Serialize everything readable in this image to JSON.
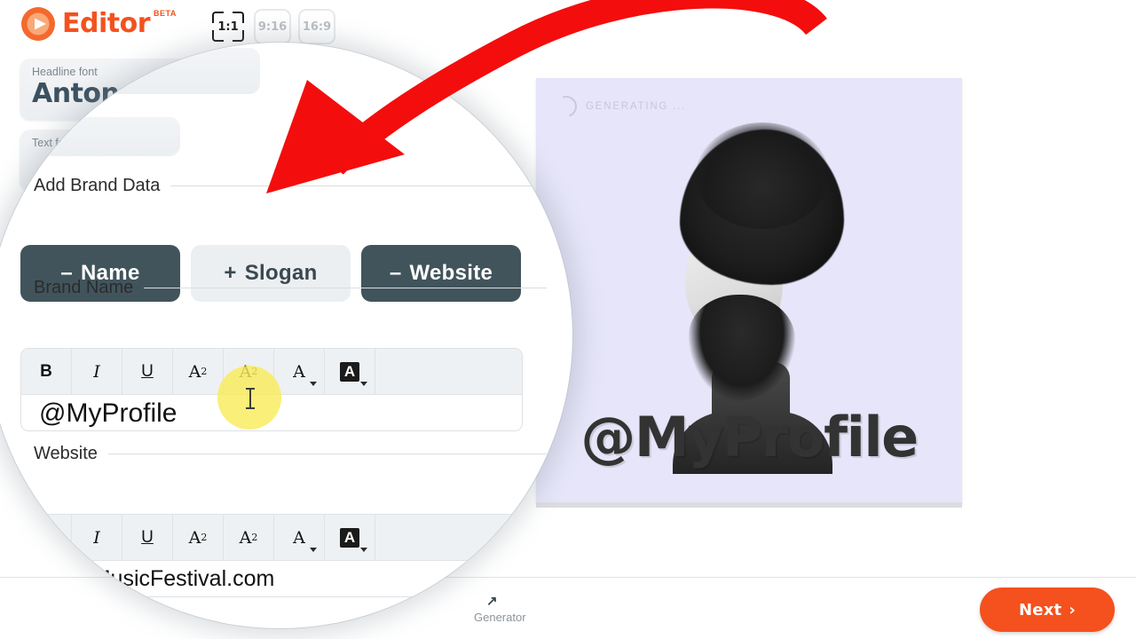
{
  "app": {
    "logo_text": "Editor",
    "logo_badge": "BETA",
    "logo_icon": "play-circle-icon"
  },
  "topbar": {
    "ratios": [
      {
        "label": "1:1",
        "selected": true
      },
      {
        "label": "9:16",
        "selected": false
      },
      {
        "label": "16:9",
        "selected": false
      }
    ]
  },
  "sidebar": {
    "cards": [
      {
        "label": "Headline font",
        "value": "Anton"
      },
      {
        "label": "Text font",
        "value": ""
      }
    ]
  },
  "magnifier": {
    "sections": {
      "add_brand_data": "Add Brand Data",
      "brand_name": "Brand Name",
      "website": "Website"
    },
    "chips": [
      {
        "sign": "–",
        "label": "Name",
        "state": "active"
      },
      {
        "sign": "+",
        "label": "Slogan",
        "state": "inactive"
      },
      {
        "sign": "–",
        "label": "Website",
        "state": "active"
      }
    ],
    "toolbar": [
      {
        "name": "bold-tool",
        "glyph": "B"
      },
      {
        "name": "italic-tool",
        "glyph": "I"
      },
      {
        "name": "underline-tool",
        "glyph": "U"
      },
      {
        "name": "superscript-tool",
        "glyph": "A"
      },
      {
        "name": "subscript-tool",
        "glyph": "A"
      },
      {
        "name": "text-color-tool",
        "glyph": "A"
      },
      {
        "name": "highlight-tool",
        "glyph": "A"
      }
    ],
    "brand_name_value": "@MyProfile",
    "website_value": "www.MusicFestival.com",
    "cursor": "text-ibeam-cursor"
  },
  "preview": {
    "status_text": "GENERATING ...",
    "status_icon": "loading-spinner-icon",
    "headline": "@MyProfile",
    "background_color": "#E6E5F9",
    "image": "bw-portrait-curly-hair-man"
  },
  "footer": {
    "label": "Generator",
    "next_label": "Next",
    "next_icon": "chevron-right-icon"
  },
  "annotation": {
    "type": "red-curved-arrow",
    "color": "#F40D0D",
    "points_at": "slogan-chip"
  },
  "colors": {
    "accent": "#F4511E",
    "dark_slate": "#41545c",
    "chip_light": "#eceff2",
    "canvas_bg": "#E6E5F9",
    "highlight": "#f9ec5a"
  }
}
